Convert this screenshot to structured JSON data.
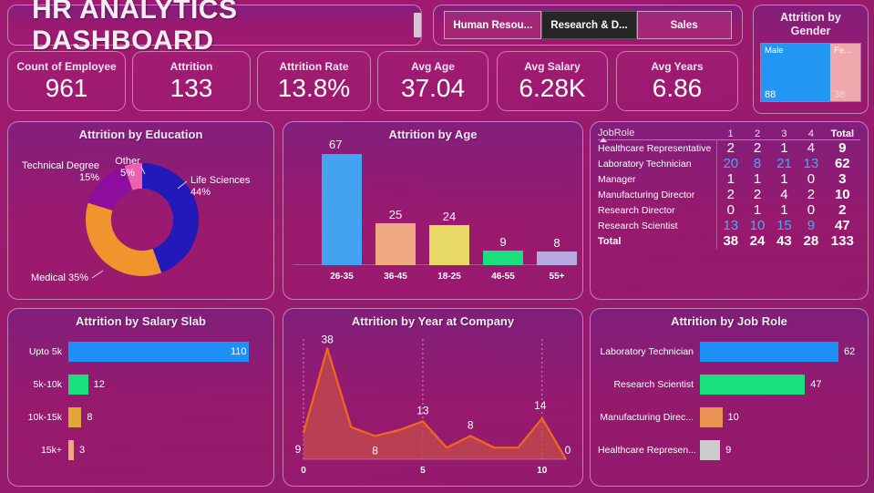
{
  "header": {
    "title": "HR ANALYTICS DASHBOARD",
    "departments": [
      {
        "label": "Human Resou...",
        "selected": false
      },
      {
        "label": "Research & D...",
        "selected": true
      },
      {
        "label": "Sales",
        "selected": false
      }
    ]
  },
  "gender": {
    "title": "Attrition by Gender",
    "items": [
      {
        "label": "Male",
        "value": "88",
        "color": "#2196f3",
        "share": 69.8
      },
      {
        "label": "Fe...",
        "value": "38",
        "color": "#efa8ab",
        "share": 30.2
      }
    ]
  },
  "kpis": [
    {
      "label": "Count of Employee",
      "value": "961"
    },
    {
      "label": "Attrition",
      "value": "133"
    },
    {
      "label": "Attrition Rate",
      "value": "13.8%"
    },
    {
      "label": "Avg Age",
      "value": "37.04"
    },
    {
      "label": "Avg Salary",
      "value": "6.28K"
    },
    {
      "label": "Avg Years",
      "value": "6.86"
    }
  ],
  "education": {
    "title": "Attrition by Education",
    "labels": [
      {
        "text": "Life Sciences",
        "pct": "44%"
      },
      {
        "text": "Medical 35%",
        "pct": ""
      },
      {
        "text": "Technical Degree",
        "pct": "15%"
      },
      {
        "text": "Other",
        "pct": "5%"
      }
    ]
  },
  "age": {
    "title": "Attrition by Age"
  },
  "matrix": {
    "role_header": "JobRole",
    "columns": [
      "1",
      "2",
      "3",
      "4"
    ],
    "total_header": "Total",
    "rows": [
      {
        "role": "Healthcare Representative",
        "values": [
          "2",
          "2",
          "1",
          "4"
        ],
        "total": "9",
        "hot": false
      },
      {
        "role": "Laboratory Technician",
        "values": [
          "20",
          "8",
          "21",
          "13"
        ],
        "total": "62",
        "hot": true
      },
      {
        "role": "Manager",
        "values": [
          "1",
          "1",
          "1",
          "0"
        ],
        "total": "3",
        "hot": false
      },
      {
        "role": "Manufacturing Director",
        "values": [
          "2",
          "2",
          "4",
          "2"
        ],
        "total": "10",
        "hot": false
      },
      {
        "role": "Research Director",
        "values": [
          "0",
          "1",
          "1",
          "0"
        ],
        "total": "2",
        "hot": false
      },
      {
        "role": "Research Scientist",
        "values": [
          "13",
          "10",
          "15",
          "9"
        ],
        "total": "47",
        "hot": true
      }
    ],
    "total_row": {
      "role": "Total",
      "values": [
        "38",
        "24",
        "43",
        "28"
      ],
      "total": "133"
    }
  },
  "salary": {
    "title": "Attrition by Salary Slab"
  },
  "year": {
    "title": "Attrition by Year at Company"
  },
  "jobrole": {
    "title": "Attrition by Job Role"
  },
  "chart_data": [
    {
      "type": "pie",
      "title": "Attrition by Education",
      "name": "education-donut",
      "categories": [
        "Life Sciences",
        "Medical",
        "Technical Degree",
        "Other"
      ],
      "values": [
        44,
        35,
        15,
        5
      ],
      "unit": "%",
      "colors": [
        "#2119b8",
        "#f0952e",
        "#8c0d9e",
        "#f060b0"
      ],
      "legend": "callout-labels",
      "hole": 0.55
    },
    {
      "type": "bar",
      "title": "Attrition by Age",
      "name": "age-column-chart",
      "categories": [
        "26-35",
        "36-45",
        "18-25",
        "46-55",
        "55+"
      ],
      "values": [
        67,
        25,
        24,
        9,
        8
      ],
      "colors": [
        "#44a3f0",
        "#f0a882",
        "#e8d864",
        "#19e07d",
        "#b6a8e0"
      ],
      "xlabel": "",
      "ylabel": "",
      "ylim": [
        0,
        70
      ],
      "grid": false
    },
    {
      "type": "table",
      "title": "JobRole matrix",
      "name": "jobrole-matrix",
      "columns": [
        "JobRole",
        "1",
        "2",
        "3",
        "4",
        "Total"
      ],
      "rows": [
        [
          "Healthcare Representative",
          2,
          2,
          1,
          4,
          9
        ],
        [
          "Laboratory Technician",
          20,
          8,
          21,
          13,
          62
        ],
        [
          "Manager",
          1,
          1,
          1,
          0,
          3
        ],
        [
          "Manufacturing Director",
          2,
          2,
          4,
          2,
          10
        ],
        [
          "Research Director",
          0,
          1,
          1,
          0,
          2
        ],
        [
          "Research Scientist",
          13,
          10,
          15,
          9,
          47
        ],
        [
          "Total",
          38,
          24,
          43,
          28,
          133
        ]
      ]
    },
    {
      "type": "bar",
      "title": "Attrition by Salary Slab",
      "name": "salary-bar-chart",
      "orientation": "horizontal",
      "categories": [
        "Upto 5k",
        "5k-10k",
        "10k-15k",
        "15k+"
      ],
      "values": [
        110,
        12,
        8,
        3
      ],
      "colors": [
        "#1f90f5",
        "#19e07d",
        "#e0a736",
        "#f0a882"
      ],
      "xlim": [
        0,
        110
      ],
      "grid": false
    },
    {
      "type": "area",
      "title": "Attrition by Year at Company",
      "name": "year-area-chart",
      "x": [
        0,
        1,
        2,
        3,
        4,
        5,
        6,
        7,
        8,
        9,
        10,
        11
      ],
      "values": [
        9,
        38,
        11,
        8,
        10,
        13,
        4,
        8,
        4,
        4,
        14,
        0
      ],
      "labeled_points": {
        "0": "9",
        "1": "38",
        "3": "8",
        "5": "13",
        "7": "8",
        "10": "14",
        "11": "0"
      },
      "xticks": [
        "0",
        "5",
        "10"
      ],
      "xlim": [
        0,
        11
      ],
      "ylim": [
        0,
        38
      ],
      "line_color": "#f0681e",
      "fill_color": "#c44a4a",
      "grid": true
    },
    {
      "type": "bar",
      "title": "Attrition by Job Role",
      "name": "jobrole-bar-chart",
      "orientation": "horizontal",
      "categories": [
        "Laboratory Technician",
        "Research Scientist",
        "Manufacturing Direc...",
        "Healthcare Represen..."
      ],
      "values": [
        62,
        47,
        10,
        9
      ],
      "colors": [
        "#1f90f5",
        "#19e07d",
        "#eb9456",
        "#cccccc"
      ],
      "xlim": [
        0,
        62
      ],
      "grid": false
    }
  ]
}
